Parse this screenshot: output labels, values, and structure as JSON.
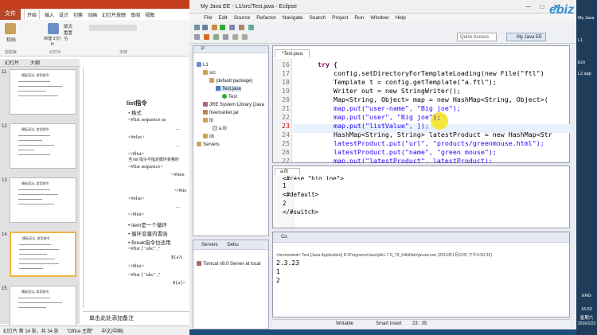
{
  "ppt": {
    "file_tab": "文件",
    "tabs": [
      "开始",
      "插入",
      "设计",
      "切换",
      "动画",
      "幻灯片放映",
      "审阅",
      "视图"
    ],
    "ribbon": {
      "paste": "粘贴",
      "new_slide": "新建\n幻灯片",
      "layout": "版式",
      "reset": "重置",
      "section": "节",
      "clipboard": "剪贴板",
      "slides_group": "幻灯片",
      "font_group": "字体"
    },
    "panel_tabs": [
      "幻灯片",
      "大纲"
    ],
    "thumbnails": [
      {
        "num": "11",
        "title": "模板语法--常用指令"
      },
      {
        "num": "12",
        "title": "模板语法--常用指令"
      },
      {
        "num": "13",
        "title": "模板语法--常用指令"
      },
      {
        "num": "14",
        "title": "模板语法--常用指令"
      },
      {
        "num": "15",
        "title": "模板语法--常用指令"
      }
    ],
    "slide_lines": [
      "list指令",
      "•    格式",
      "<#list sequence as",
      "...",
      "<#else>",
      "...",
      "</#list>",
      "当 list 指令不指定循环变量时",
      "<#list sequence>",
      "<#iten",
      "</#ite",
      "<#else>",
      "...",
      "</#list>",
      "•    item是一个循环",
      "•    循环变量内置函",
      "•    Break指令也适用",
      "<#list [ \"abc\" ,\"",
      "${a?i",
      "</#list>",
      "<#list [ \"abc\" ,\"",
      "${a}<"
    ],
    "notes": "单击此处添加备注",
    "status": [
      "幻灯片 第 14 张，共 34 张",
      "\"Office 主题\"",
      "中文(中国)"
    ]
  },
  "eclipse": {
    "title": "My Java EE - L1/src/Test.java - Eclipse",
    "menu": [
      "File",
      "Edit",
      "Source",
      "Refactor",
      "Navigate",
      "Search",
      "Project",
      "Run",
      "Window",
      "Help"
    ],
    "quick_access": "Quick Access",
    "perspective": "My Java EE",
    "explorer": {
      "tab": "P",
      "tree": [
        "L1",
        "src",
        "(default package)",
        "Test.java",
        "Test",
        "JRE System Library [Java",
        "freemarker.jar",
        "ftl",
        "a.ftl",
        "lib",
        "Servers"
      ]
    },
    "servers": {
      "tabs": [
        "Servers",
        "Debu"
      ],
      "item": "Tomcat v8.0 Server at local"
    },
    "editor": {
      "tab": "*Test.java",
      "line_numbers": [
        "16",
        "17",
        "18",
        "19",
        "20",
        "21",
        "22",
        "23",
        "24",
        "25",
        "26",
        "27"
      ],
      "code": [
        "try {",
        "config.setDirectoryForTemplateLoading(new File(\"ftl\")",
        "Template t = config.getTemplate(\"a.ftl\");",
        "Writer out = new StringWriter();",
        "Map<String, Object> map = new HashMap<String, Object>(",
        "map.put(\"user-name\", \"Big joe\");",
        "map.put(\"user\", \"Big joe\");",
        "map.put(\"listValue\", ]);",
        "HashMap<String, String> latestProduct = new HashMap<Str",
        "latestProduct.put(\"url\", \"products/greenmouse.html\");",
        "latestProduct.put(\"name\", \"green mouse\");",
        "map.put(\"latestProduct\", latestProduct);"
      ]
    },
    "ftl": {
      "tab": "a.ftl",
      "lines": [
        "<#case \"big joe\">",
        "1",
        "<#default>",
        "2",
        "</#switch>"
      ]
    },
    "console": {
      "tab": "Co",
      "terminated": "<terminated> Test [Java Application] D:\\Programs\\Java\\jdk1.7.0_79_64bit\\bin\\javaw.exe (2016年1月23日 下午4:50:32)",
      "output": [
        "2.3.23",
        "1",
        "2"
      ]
    },
    "status": {
      "mode": "Writable",
      "insert": "Smart Insert",
      "position": "23 : 35"
    }
  },
  "taskbar": {
    "items": [
      "My Java",
      "L1",
      "Ecli",
      "L2.app"
    ],
    "lang": "ENG",
    "time": "16:52",
    "weekday": "星期六",
    "date": "2016/1/23"
  },
  "watermark": "ebiz"
}
